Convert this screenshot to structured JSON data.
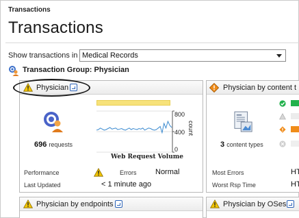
{
  "breadcrumb": "Transactions",
  "page_title": "Transactions",
  "filter": {
    "label": "Show transactions in",
    "selected": "Medical Records"
  },
  "group": {
    "title": "Transaction Group: Physician"
  },
  "tiles": {
    "physician": {
      "title": "Physician",
      "requests_count": "696",
      "requests_unit": "requests",
      "chart_title": "Web Request Volume",
      "y_axis_title": "count",
      "performance_label": "Performance",
      "errors_label": "Errors",
      "errors_value": "Normal",
      "last_updated_label": "Last Updated",
      "last_updated_value": "< 1 minute ago"
    },
    "content_type": {
      "title": "Physician by content t",
      "content_count": "3",
      "content_unit": "content types",
      "most_errors_label": "Most Errors",
      "most_errors_value": "HT",
      "worst_rsp_label": "Worst Rsp Time",
      "worst_rsp_value": "HT"
    },
    "endpoints": {
      "title": "Physician by endpoints"
    },
    "oses": {
      "title": "Physician by OSes"
    }
  },
  "colors": {
    "warning": "#f2c500",
    "accent_green": "#22b14c",
    "accent_orange": "#f08c1a",
    "bar_yellow": "#f7e27a",
    "line_blue": "#3a8ad0"
  },
  "chart_data": {
    "type": "line",
    "title": "Web Request Volume",
    "ylabel": "count",
    "y_ticks": [
      "800",
      "400",
      "0"
    ],
    "ylim": [
      0,
      800
    ],
    "values": [
      430,
      440,
      470,
      450,
      430,
      440,
      460,
      480,
      450,
      460,
      470,
      440,
      450,
      460,
      440,
      430,
      450,
      470,
      440,
      460,
      450,
      440,
      460,
      450,
      470,
      430,
      450,
      470,
      460,
      440,
      430,
      440,
      470,
      500,
      380,
      560,
      470,
      600,
      520,
      480
    ]
  }
}
